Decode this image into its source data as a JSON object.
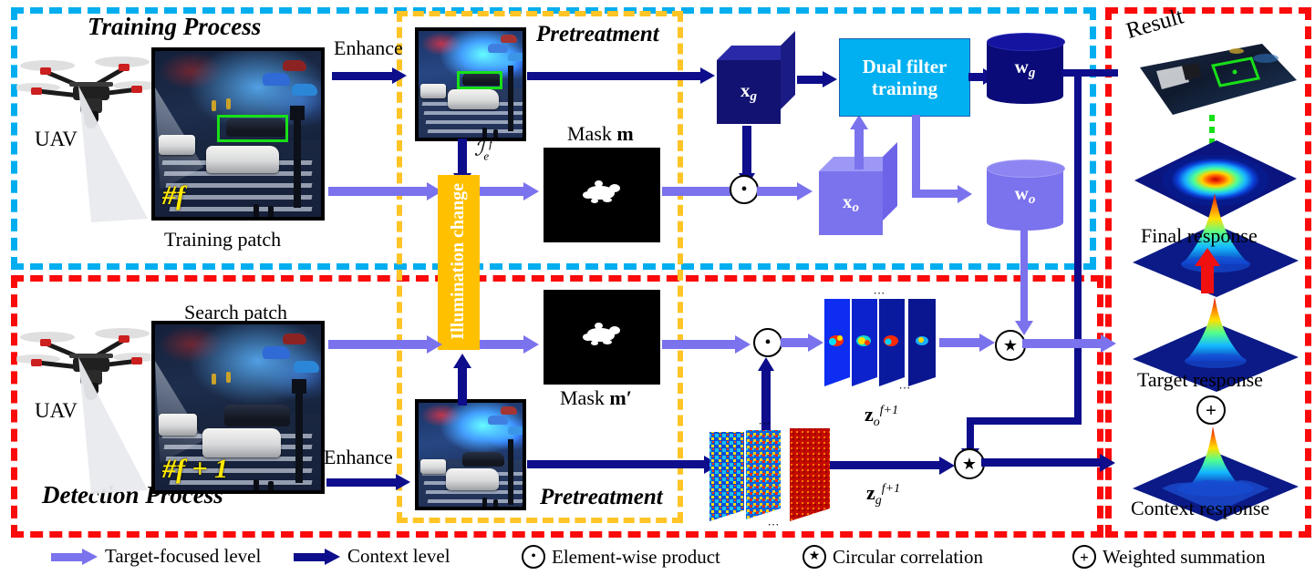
{
  "figure": {
    "regions": {
      "training": {
        "label": "Training Process",
        "border_color": "#00aeef"
      },
      "detection": {
        "label": "Detection Process",
        "border_color": "#fa0a0a"
      },
      "pretreatment_top": {
        "label": "Pretreatment",
        "border_color": "#ffc425"
      },
      "pretreatment_bottom": {
        "label": "Pretreatment"
      },
      "result": {
        "label": "Result",
        "border_color": "#fa0a0a"
      }
    },
    "training": {
      "uav_label": "UAV",
      "patch_label": "Training patch",
      "frame_number": "#f",
      "enhance_label": "Enhance",
      "enhanced_symbol": "ℐ",
      "enhanced_sub": "e",
      "enhanced_sup": "f",
      "mask_label": "Mask",
      "mask_symbol": "m",
      "cube_g": "x",
      "cube_g_sub": "g",
      "cube_o": "x",
      "cube_o_sub": "o",
      "dual_filter": "Dual filter\ntraining",
      "dual_filter_line1": "Dual filter",
      "dual_filter_line2": "training",
      "filter_g": "w",
      "filter_g_sub": "g",
      "filter_o": "w",
      "filter_o_sub": "o"
    },
    "detection": {
      "uav_label": "UAV",
      "patch_label": "Search patch",
      "frame_number": "#f + 1",
      "enhance_label": "Enhance",
      "mask_label": "Mask",
      "mask_symbol": "m′",
      "illumination_label": "Illumination change",
      "zo_symbol": "z",
      "zo_sub": "o",
      "zo_sup": "f+1",
      "zg_symbol": "z",
      "zg_sub": "g",
      "zg_sup": "f+1",
      "ellipsis": "···"
    },
    "responses": {
      "final": "Final response",
      "target": "Target response",
      "context": "Context response"
    },
    "legend": [
      {
        "icon": "arrow-light-purple",
        "label": "Target-focused level",
        "color": "#7b72ed"
      },
      {
        "icon": "arrow-navy",
        "label": "Context level",
        "color": "#0e0e8c"
      },
      {
        "icon": "dot-circle",
        "glyph": "⊙",
        "label": "Element-wise product"
      },
      {
        "icon": "star-circle",
        "glyph": "★",
        "label": "Circular correlation"
      },
      {
        "icon": "plus-circle",
        "glyph": "✚",
        "label": "Weighted summation"
      }
    ],
    "colors": {
      "target_level": "#7b72ed",
      "context_level": "#0e0e8c",
      "cyan_box": "#00aeef",
      "red_box": "#fa0a0a",
      "orange_box": "#ffc425",
      "dual_filter_fill": "#00b0f0",
      "illumination_fill": "#ffc000",
      "bbox_green": "#18e018"
    }
  }
}
